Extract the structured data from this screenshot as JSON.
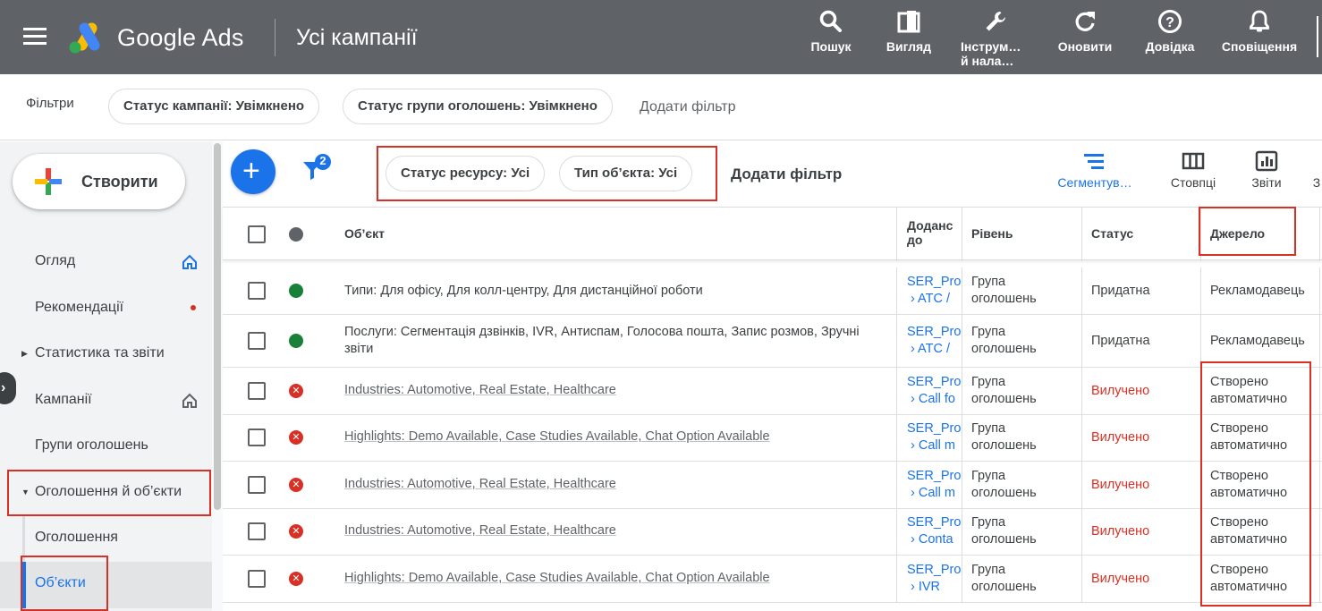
{
  "topbar": {
    "brand": "Google Ads",
    "title": "Усі кампанії",
    "tools": {
      "search": "Пошук",
      "view": "Вигляд",
      "tools_line1": "Інструм…",
      "tools_line2": "й нала…",
      "refresh": "Оновити",
      "help": "Довідка",
      "notifications": "Сповіщення"
    }
  },
  "filters": {
    "label": "Фільтри",
    "chips": [
      "Статус кампанії: Увімкнено",
      "Статус групи оголошень: Увімкнено"
    ],
    "add": "Додати фільтр"
  },
  "sidebar": {
    "create": "Створити",
    "items": [
      {
        "label": "Огляд"
      },
      {
        "label": "Рекомендації"
      },
      {
        "label": "Статистика та звіти"
      },
      {
        "label": "Кампанії"
      },
      {
        "label": "Групи оголошень"
      },
      {
        "label": "Оголошення й об’єкти"
      },
      {
        "label": "Оголошення"
      },
      {
        "label": "Об’єкти"
      }
    ]
  },
  "toolbar": {
    "filter_badge": "2",
    "chips": [
      "Статус ресурсу: Усі",
      "Тип об’єкта: Усі"
    ],
    "add": "Додати фільтр",
    "segment": "Сегментув…",
    "columns": "Стовпці",
    "reports": "Звіти",
    "more": "З"
  },
  "table": {
    "headers": {
      "object": "Об’єкт",
      "added_line1": "Доданс",
      "added_line2": "до",
      "level": "Рівень",
      "status": "Статус",
      "source": "Джерело"
    },
    "rows": [
      {
        "object": "Типи: Для офісу, Для колл-центру, Для дистанційної роботи",
        "added1": "SER_Proc",
        "added2": "› ATC /",
        "level1": "Група",
        "level2": "оголошень",
        "status": "Придатна",
        "source1": "Рекламодавець",
        "source2": ""
      },
      {
        "object": "Послуги: Сегментація дзвінків, IVR, Антиспам, Голосова пошта, Запис розмов, Зручні звіти",
        "added1": "SER_Proc",
        "added2": "› ATC /",
        "level1": "Група",
        "level2": "оголошень",
        "status": "Придатна",
        "source1": "Рекламодавець",
        "source2": ""
      },
      {
        "object": "Industries: Automotive, Real Estate, Healthcare",
        "added1": "SER_Proc",
        "added2": "› Call fo",
        "level1": "Група",
        "level2": "оголошень",
        "status": "Вилучено",
        "source1": "Створено",
        "source2": "автоматично"
      },
      {
        "object": "Highlights: Demo Available, Case Studies Available, Chat Option Available",
        "added1": "SER_Proc",
        "added2": "› Call m",
        "level1": "Група",
        "level2": "оголошень",
        "status": "Вилучено",
        "source1": "Створено",
        "source2": "автоматично"
      },
      {
        "object": "Industries: Automotive, Real Estate, Healthcare",
        "added1": "SER_Proc",
        "added2": "› Call m",
        "level1": "Група",
        "level2": "оголошень",
        "status": "Вилучено",
        "source1": "Створено",
        "source2": "автоматично"
      },
      {
        "object": "Industries: Automotive, Real Estate, Healthcare",
        "added1": "SER_Proc",
        "added2": "› Conta",
        "level1": "Група",
        "level2": "оголошень",
        "status": "Вилучено",
        "source1": "Створено",
        "source2": "автоматично"
      },
      {
        "object": "Highlights: Demo Available, Case Studies Available, Chat Option Available",
        "added1": "SER_Proc",
        "added2": "› IVR",
        "level1": "Група",
        "level2": "оголошень",
        "status": "Вилучено",
        "source1": "Створено",
        "source2": "автоматично"
      }
    ]
  },
  "colors": {
    "topbar": "#5f6368",
    "accent": "#1a73e8",
    "eligible": "#188038",
    "removed": "#d93025",
    "highlight_box": "#d93025"
  }
}
